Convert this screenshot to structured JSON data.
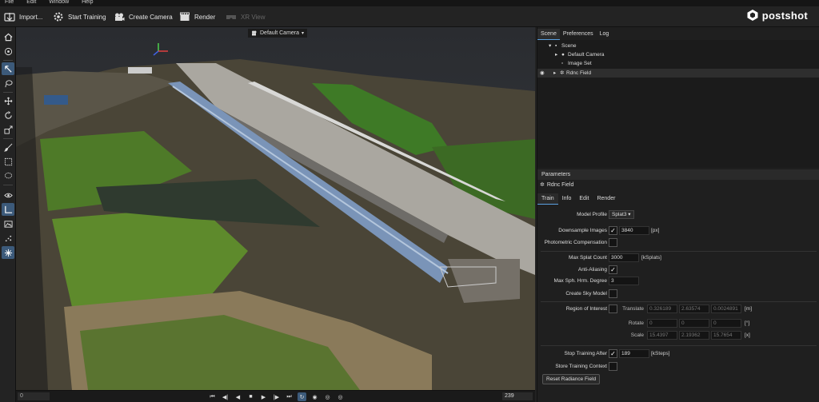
{
  "menu": [
    "File",
    "Edit",
    "Window",
    "Help"
  ],
  "toolbar": {
    "import": "Import...",
    "start_training": "Start Training",
    "create_camera": "Create Camera",
    "render": "Render",
    "xr_view": "XR View"
  },
  "logo": "postshot",
  "viewport": {
    "camera_label": "Default Camera"
  },
  "playback": {
    "frame_start": "0",
    "frame_end": "239"
  },
  "right_tabs": [
    "Scene",
    "Preferences",
    "Log"
  ],
  "scene_tree": {
    "root": "Scene",
    "camera": "Default Camera",
    "image_set": "Image Set",
    "field": "Rdnc Field"
  },
  "params": {
    "header": "Parameters",
    "field_name": "Rdnc Field",
    "tabs": [
      "Train",
      "Info",
      "Edit",
      "Render"
    ],
    "model_profile_label": "Model Profile",
    "model_profile_value": "Splat3",
    "downsample_label": "Downsample Images",
    "downsample_value": "3840",
    "downsample_unit": "[px]",
    "photometric_label": "Photometric Compensation",
    "max_splat_label": "Max Splat Count",
    "max_splat_value": "3000",
    "max_splat_unit": "[kSplats]",
    "anti_alias_label": "Anti-Aliasing",
    "max_sph_label": "Max Sph. Hrm. Degree",
    "max_sph_value": "3",
    "sky_label": "Create Sky Model",
    "roi_label": "Region of Interest",
    "translate_label": "Translate",
    "translate": [
      "0.326189",
      "2.63574",
      "0.0024891"
    ],
    "translate_unit": "[m]",
    "rotate_label": "Rotate",
    "rotate": [
      "0",
      "0",
      "0"
    ],
    "rotate_unit": "[°]",
    "scale_label": "Scale",
    "scale": [
      "15.4397",
      "2.19362",
      "15.7654"
    ],
    "scale_unit": "[x]",
    "stop_label": "Stop Training After",
    "stop_value": "189",
    "stop_unit": "[kSteps]",
    "store_label": "Store Training Context",
    "reset_button": "Reset Radiance Field"
  }
}
